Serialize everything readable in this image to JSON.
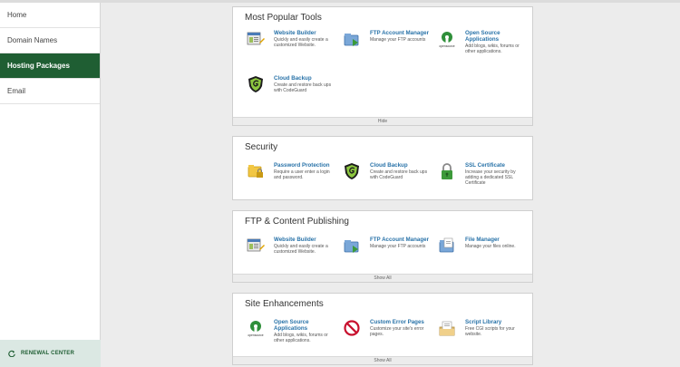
{
  "sidebar": {
    "items": [
      {
        "label": "Home"
      },
      {
        "label": "Domain Names"
      },
      {
        "label": "Hosting Packages"
      },
      {
        "label": "Email"
      }
    ],
    "renewal_label": "RENEWAL CENTER"
  },
  "panels": [
    {
      "title": "Most Popular Tools",
      "footer": "Hide",
      "tools": [
        {
          "icon": "website-builder-icon",
          "title": "Website Builder",
          "desc": "Quickly and easily create a customized Website."
        },
        {
          "icon": "ftp-icon",
          "title": "FTP Account Manager",
          "desc": "Manage your FTP accounts"
        },
        {
          "icon": "open-source-icon",
          "title": "Open Source Applications",
          "desc": "Add blogs, wikis, forums or other applications."
        },
        {
          "icon": "codeguard-icon",
          "title": "Cloud Backup",
          "desc": "Create and restore back ups with CodeGuard"
        }
      ]
    },
    {
      "title": "Security",
      "footer": "",
      "tools": [
        {
          "icon": "folder-lock-icon",
          "title": "Password Protection",
          "desc": "Require a user enter a login and password."
        },
        {
          "icon": "codeguard-icon",
          "title": "Cloud Backup",
          "desc": "Create and restore back ups with CodeGuard"
        },
        {
          "icon": "padlock-icon",
          "title": "SSL Certificate",
          "desc": "Increase your security by adding a dedicated SSL Certificate"
        }
      ]
    },
    {
      "title": "FTP & Content Publishing",
      "footer": "Show All",
      "tools": [
        {
          "icon": "website-builder-icon",
          "title": "Website Builder",
          "desc": "Quickly and easily create a customized Website."
        },
        {
          "icon": "ftp-icon",
          "title": "FTP Account Manager",
          "desc": "Manage your FTP accounts"
        },
        {
          "icon": "file-manager-icon",
          "title": "File Manager",
          "desc": "Manage your files online."
        }
      ]
    },
    {
      "title": "Site Enhancements",
      "footer": "Show All",
      "tools": [
        {
          "icon": "open-source-icon",
          "title": "Open Source Applications",
          "desc": "Add blogs, wikis, forums or other applications."
        },
        {
          "icon": "error-pages-icon",
          "title": "Custom Error Pages",
          "desc": "Customize your site's error pages."
        },
        {
          "icon": "script-library-icon",
          "title": "Script Library",
          "desc": "Free CGI scripts for your website."
        }
      ]
    }
  ],
  "icon_labels": {
    "open_source": "opensource"
  },
  "colors": {
    "accent": "#1f5e33",
    "link": "#2872a8",
    "renewal_bg": "#dbe8e3"
  }
}
